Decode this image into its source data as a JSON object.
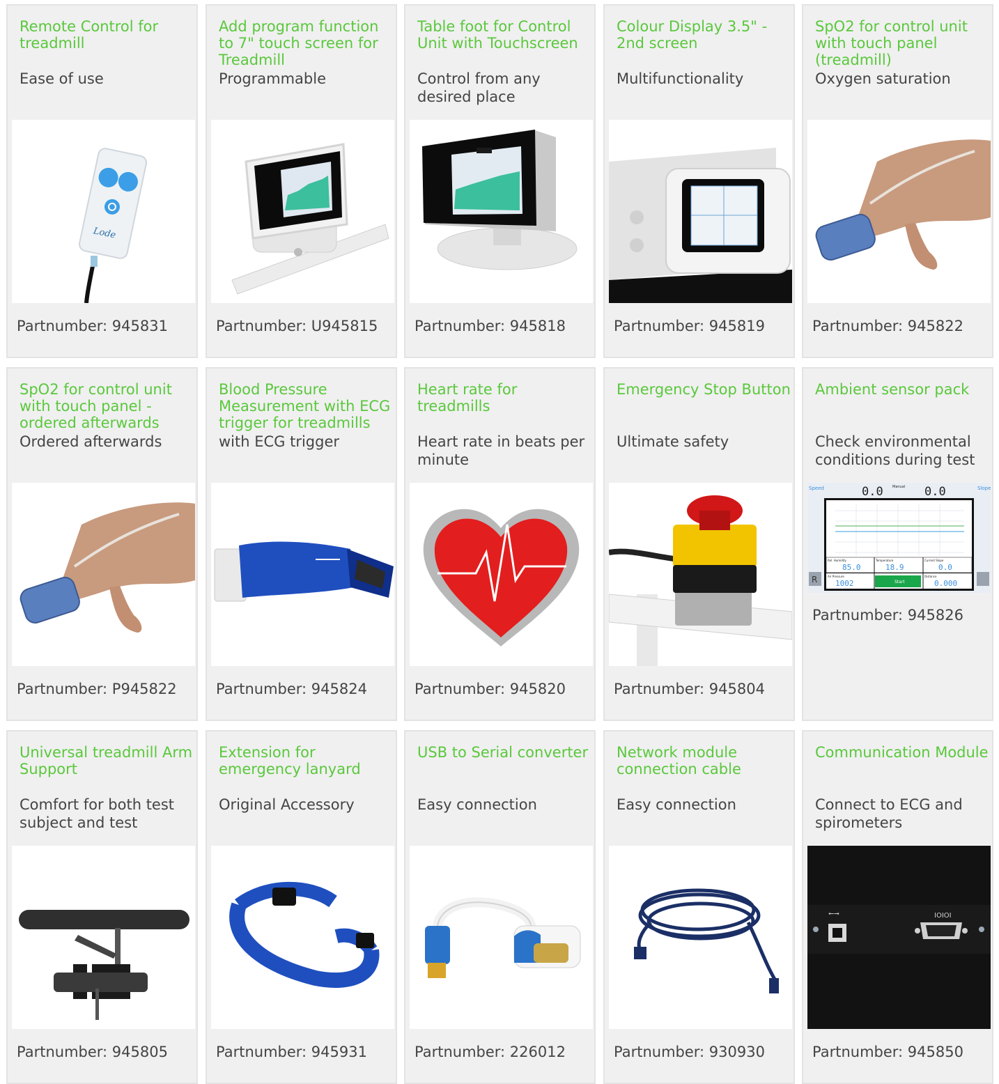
{
  "products": [
    {
      "title": "Remote Control for treadmill",
      "subtitle": "Ease of use",
      "partnumber": "Partnumber: 945831",
      "image_icon": "remote-control-icon"
    },
    {
      "title": "Add program function to 7\" touch screen for Treadmill",
      "subtitle": "Programmable",
      "partnumber": "Partnumber: U945815",
      "image_icon": "touch-screen-icon"
    },
    {
      "title": "Table foot for Control Unit with Touchscreen",
      "subtitle": "Control from any desired place",
      "partnumber": "Partnumber: 945818",
      "image_icon": "table-foot-screen-icon"
    },
    {
      "title": "Colour Display 3.5\" - 2nd screen",
      "subtitle": "Multifunctionality",
      "partnumber": "Partnumber: 945819",
      "image_icon": "colour-display-icon"
    },
    {
      "title": "SpO2 for control unit with touch panel (treadmill)",
      "subtitle": "Oxygen saturation",
      "partnumber": "Partnumber: 945822",
      "image_icon": "finger-sensor-icon"
    },
    {
      "title": "SpO2 for control unit with touch panel - ordered afterwards",
      "subtitle": "Ordered afterwards",
      "partnumber": "Partnumber: P945822",
      "image_icon": "finger-sensor-icon"
    },
    {
      "title": "Blood Pressure Measurement with ECG trigger for treadmills",
      "subtitle": "with ECG trigger",
      "partnumber": "Partnumber: 945824",
      "image_icon": "blood-pressure-cuff-icon"
    },
    {
      "title": "Heart rate for treadmills",
      "subtitle": "Heart rate in beats per minute",
      "partnumber": "Partnumber: 945820",
      "image_icon": "heart-rate-icon"
    },
    {
      "title": "Emergency Stop Button",
      "subtitle": "Ultimate safety",
      "partnumber": "Partnumber: 945804",
      "image_icon": "emergency-stop-icon"
    },
    {
      "title": "Ambient sensor pack",
      "subtitle": "Check environmental conditions during test",
      "partnumber": "Partnumber: 945826",
      "image_icon": "ambient-sensor-screen-icon"
    },
    {
      "title": "Universal treadmill Arm Support",
      "subtitle": "Comfort for both test subject and test",
      "partnumber": "Partnumber: 945805",
      "image_icon": "arm-support-icon"
    },
    {
      "title": "Extension for emergency lanyard",
      "subtitle": "Original Accessory",
      "partnumber": "Partnumber: 945931",
      "image_icon": "lanyard-icon"
    },
    {
      "title": "USB to Serial converter",
      "subtitle": "Easy connection",
      "partnumber": "Partnumber: 226012",
      "image_icon": "usb-serial-cable-icon"
    },
    {
      "title": "Network module connection cable",
      "subtitle": "Easy connection",
      "partnumber": "Partnumber: 930930",
      "image_icon": "network-cable-icon"
    },
    {
      "title": "Communication Module",
      "subtitle": "Connect to ECG and spirometers",
      "partnumber": "Partnumber: 945850",
      "image_icon": "communication-module-icon"
    }
  ],
  "screen_text": {
    "speed": "Speed",
    "manual": "Manual",
    "slope": "Slope",
    "speed_value": "0.0",
    "slope_value": "0.0",
    "rel_humidity": "Rel. Humidity",
    "rel_humidity_value": "85.0",
    "temperature": "Temperature",
    "temperature_value": "18.9",
    "current_slope": "Current Slope",
    "current_slope_value": "0.0",
    "air_pressure": "Air Pressure",
    "air_pressure_value": "1002",
    "start": "Start",
    "distance": "Distance",
    "distance_value": "0.000",
    "reset": "R",
    "usb_symbol": "⭠⭢",
    "serial_label": "IOIOI",
    "brand": "Lode"
  },
  "colors": {
    "title_green": "#5ac83c",
    "card_bg": "#f0f0f0",
    "card_border": "#e3e3e3",
    "text": "#444444"
  }
}
